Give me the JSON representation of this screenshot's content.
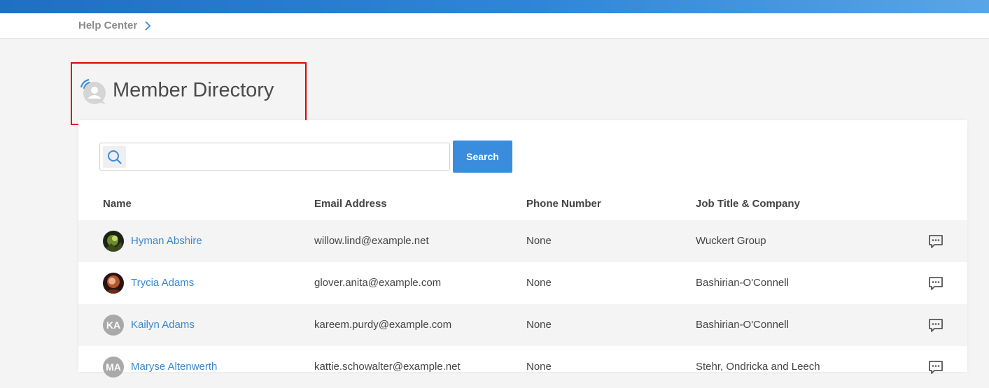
{
  "breadcrumb": {
    "label": "Help Center"
  },
  "page": {
    "title": "Member Directory"
  },
  "search": {
    "placeholder": "",
    "button_label": "Search"
  },
  "table": {
    "columns": [
      "Name",
      "Email Address",
      "Phone Number",
      "Job Title & Company"
    ],
    "rows": [
      {
        "name": "Hyman Abshire",
        "email": "willow.lind@example.net",
        "phone": "None",
        "company": "Wuckert Group",
        "avatar": "photo",
        "initials": ""
      },
      {
        "name": "Trycia Adams",
        "email": "glover.anita@example.com",
        "phone": "None",
        "company": "Bashirian-O'Connell",
        "avatar": "photo",
        "initials": ""
      },
      {
        "name": "Kailyn Adams",
        "email": "kareem.purdy@example.com",
        "phone": "None",
        "company": "Bashirian-O'Connell",
        "avatar": "initials",
        "initials": "KA"
      },
      {
        "name": "Maryse Altenwerth",
        "email": "kattie.schowalter@example.net",
        "phone": "None",
        "company": "Stehr, Ondricka and Leech",
        "avatar": "initials",
        "initials": "MA"
      }
    ]
  },
  "colors": {
    "accent": "#3a8ddc",
    "link": "#3a87cf",
    "highlight_border": "#e30000"
  },
  "icons": {
    "breadcrumb": "chevron-right-icon",
    "header": "member-directory-icon",
    "search": "search-icon",
    "message": "message-icon"
  }
}
